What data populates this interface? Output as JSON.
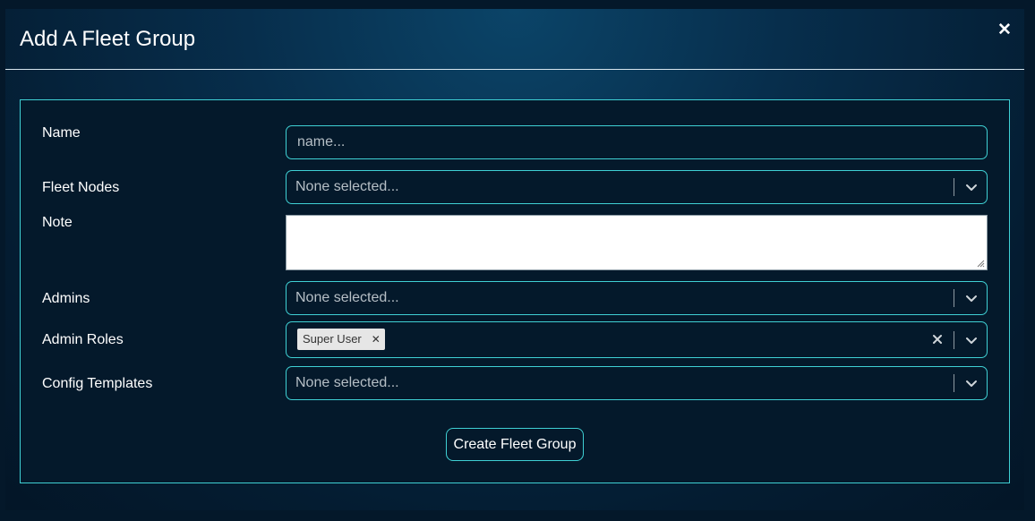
{
  "modal": {
    "title": "Add A Fleet Group",
    "close_icon": "close-icon"
  },
  "form": {
    "name": {
      "label": "Name",
      "placeholder": "name...",
      "value": ""
    },
    "fleet_nodes": {
      "label": "Fleet Nodes",
      "placeholder": "None selected..."
    },
    "note": {
      "label": "Note",
      "value": ""
    },
    "admins": {
      "label": "Admins",
      "placeholder": "None selected..."
    },
    "admin_roles": {
      "label": "Admin Roles",
      "selected": [
        "Super User"
      ]
    },
    "config_templates": {
      "label": "Config Templates",
      "placeholder": "None selected..."
    },
    "submit_label": "Create Fleet Group"
  },
  "colors": {
    "accent": "#3fd0d4",
    "background": "#04192b",
    "text": "#ffffff",
    "placeholder": "#b6bfc6"
  }
}
